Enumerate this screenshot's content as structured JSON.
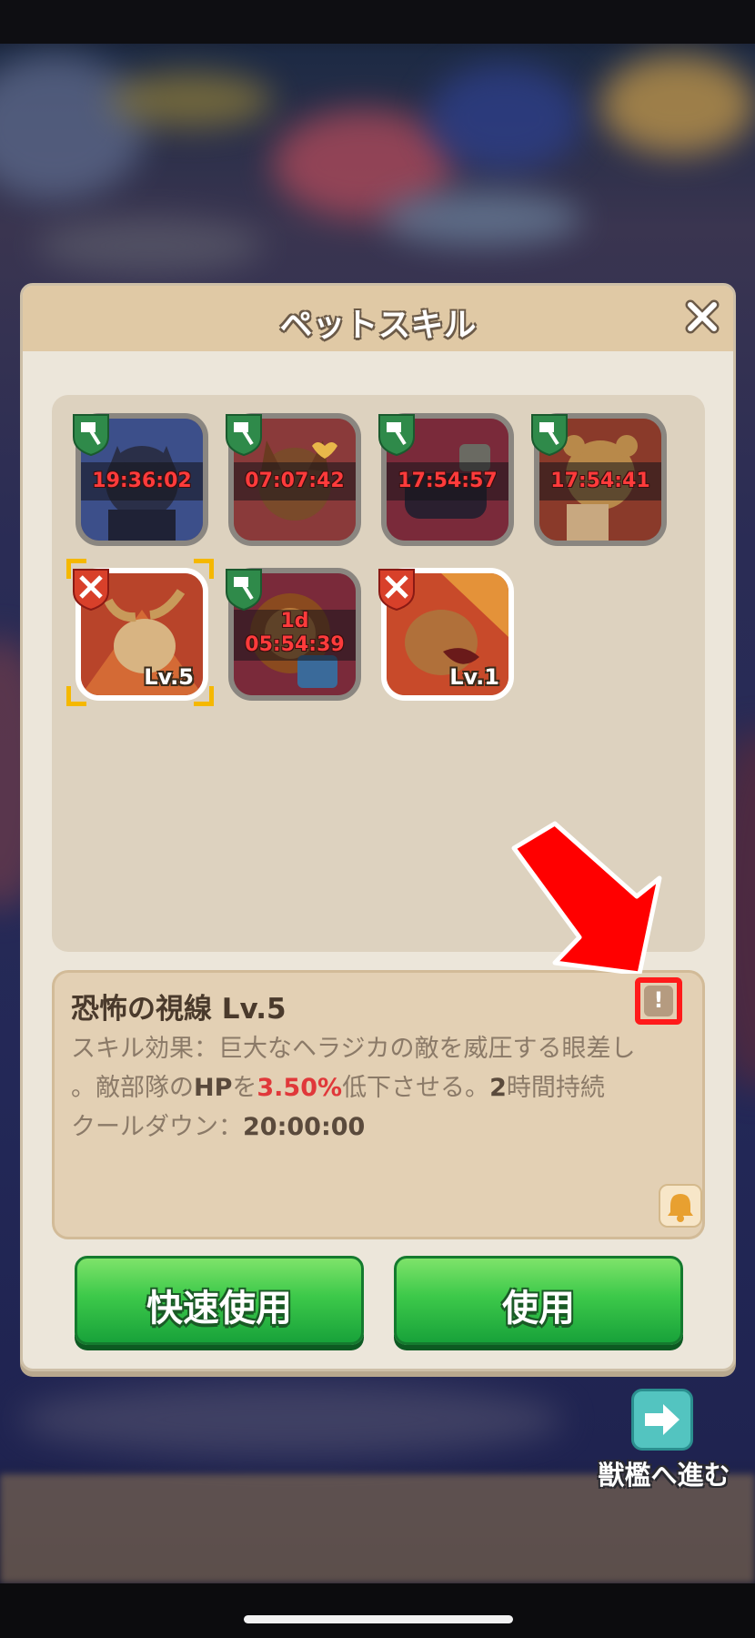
{
  "window": {
    "title": "ペットスキル",
    "close_icon": "close-icon"
  },
  "skills": [
    {
      "state": "locked",
      "badge": "hammer-badge",
      "timer": "19:36:02",
      "art": "dark-wolf"
    },
    {
      "state": "locked",
      "badge": "hammer-badge",
      "timer": "07:07:42",
      "art": "lynx"
    },
    {
      "state": "locked",
      "badge": "hammer-badge",
      "timer": "17:54:57",
      "art": "dark-beast"
    },
    {
      "state": "locked",
      "badge": "hammer-badge",
      "timer": "17:54:41",
      "art": "bear-cub"
    },
    {
      "state": "owned",
      "badge": "swords-badge",
      "level": "Lv.5",
      "selected": true,
      "art": "moose"
    },
    {
      "state": "locked",
      "badge": "hammer-badge",
      "timer_day": "1d",
      "timer": "05:54:39",
      "art": "lion"
    },
    {
      "state": "owned",
      "badge": "swords-badge",
      "level": "Lv.1",
      "art": "roaring-bear"
    }
  ],
  "selected_skill": {
    "name": "恐怖の視線 Lv.5",
    "effect_prefix": "スキル効果：巨大なヘラジカの敵を威圧する眼差し",
    "effect_line2_a": "。敵部隊の",
    "effect_hp": "HP",
    "effect_line2_b": "を",
    "effect_value": "3.50%",
    "effect_line2_c": "低下させる。",
    "effect_duration_num": "2",
    "effect_duration_text": "時間持続",
    "cooldown_label": "クールダウン：",
    "cooldown_value": "20:00:00",
    "info_icon": "!"
  },
  "buttons": {
    "quick_use": "快速使用",
    "use": "使用"
  },
  "footer": {
    "go_label": "獣檻へ進む"
  },
  "colors": {
    "accent_red": "#ff1a1a",
    "button_green": "#3dc94a",
    "timer_red": "#ff3b3b"
  }
}
